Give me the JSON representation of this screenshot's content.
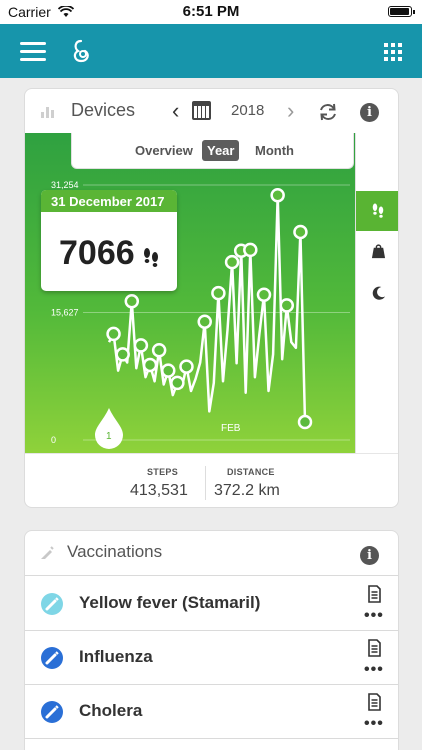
{
  "status_bar": {
    "carrier": "Carrier",
    "time": "6:51 PM",
    "battery_level": 1.0
  },
  "devices": {
    "title": "Devices",
    "year": "2018",
    "tabs": {
      "overview": "Overview",
      "year": "Year",
      "month": "Month"
    },
    "selected_tab": "Year",
    "tooltip": {
      "date": "31 December 2017",
      "value": "7066",
      "icon": "footsteps-icon"
    },
    "side_tabs": [
      "footsteps-icon",
      "weight-icon",
      "moon-icon"
    ],
    "stats": {
      "steps_label": "STEPS",
      "steps_value": "413,531",
      "distance_label": "DISTANCE",
      "distance_value": "372.2 km"
    }
  },
  "chart_data": {
    "type": "line",
    "series": [
      {
        "values": [
          12000,
          13000,
          8500,
          10500,
          9500,
          17000,
          8800,
          11600,
          7700,
          9200,
          7200,
          11000,
          6800,
          8500,
          5500,
          7000,
          6500,
          9000,
          6000,
          7500,
          9500,
          14500,
          3500,
          7000,
          18000,
          7200,
          13500,
          21800,
          9400,
          23200,
          5800,
          23300,
          7700,
          13000,
          17800,
          6000,
          10500,
          30000,
          9900,
          16500,
          12000,
          11300,
          25500,
          2200
        ]
      }
    ],
    "ytick_labels": [
      "31,254",
      "15,627",
      "0"
    ],
    "ylim": [
      0,
      31254
    ],
    "xtick_labels": [
      "FEB"
    ],
    "month_marker": "1",
    "title": "",
    "xlabel": "",
    "ylabel": "",
    "line_color": "#ffffff",
    "background_colors": [
      "#2fa140",
      "#8fd23a"
    ]
  },
  "vaccinations": {
    "title": "Vaccinations",
    "items": [
      {
        "name": "Yellow fever (Stamaril)",
        "badge_color": "#7fd6e6",
        "more": "•••"
      },
      {
        "name": "Influenza",
        "badge_color": "#2a6fd6",
        "more": "•••"
      },
      {
        "name": "Cholera",
        "badge_color": "#2a6fd6",
        "more": "•••"
      }
    ]
  },
  "colors": {
    "app_bar": "#1795ab",
    "accent_green": "#59b433"
  }
}
